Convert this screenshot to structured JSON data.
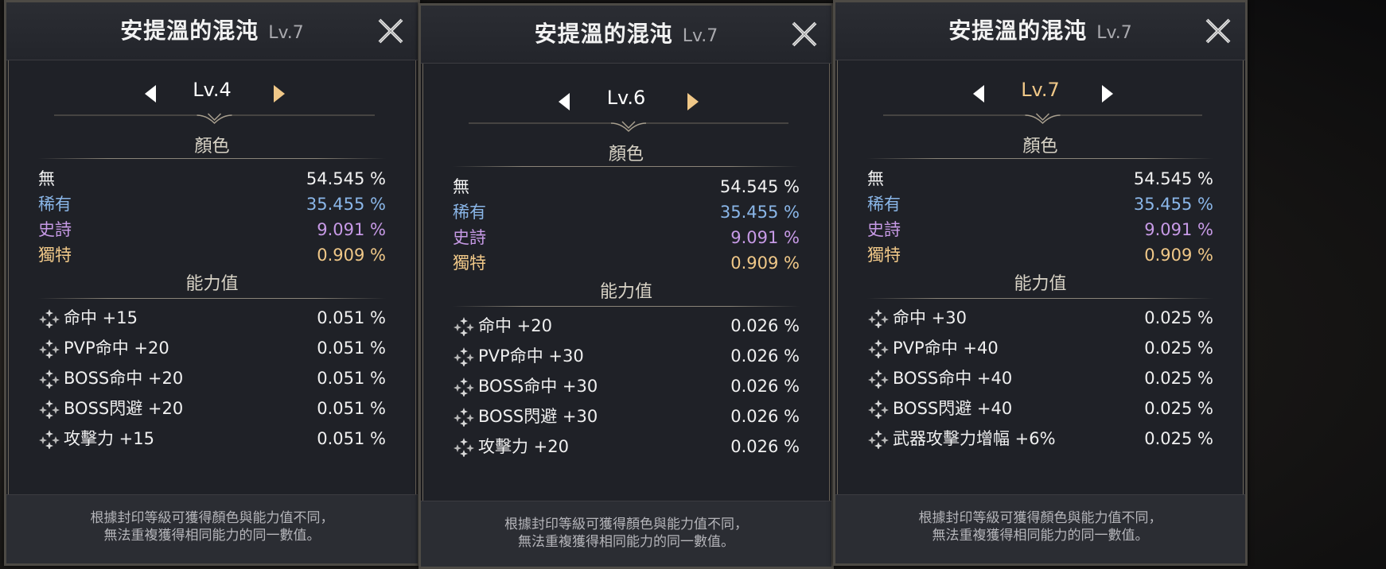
{
  "panels": [
    {
      "title": "安提溫的混沌",
      "title_level": "Lv.7",
      "current_level": "Lv.4",
      "section_color": "顏色",
      "section_stats": "能力值",
      "colors": [
        {
          "label": "無",
          "value": "54.545 %"
        },
        {
          "label": "稀有",
          "value": "35.455 %"
        },
        {
          "label": "史詩",
          "value": "9.091 %"
        },
        {
          "label": "獨特",
          "value": "0.909 %"
        }
      ],
      "stats": [
        {
          "label": "命中 +15",
          "value": "0.051 %"
        },
        {
          "label": "PVP命中 +20",
          "value": "0.051 %"
        },
        {
          "label": "BOSS命中 +20",
          "value": "0.051 %"
        },
        {
          "label": "BOSS閃避 +20",
          "value": "0.051 %"
        },
        {
          "label": "攻擊力 +15",
          "value": "0.051 %"
        }
      ],
      "note_line1": "根據封印等級可獲得顏色與能力值不同，",
      "note_line2": "無法重複獲得相同能力的同一數值。"
    },
    {
      "title": "安提溫的混沌",
      "title_level": "Lv.7",
      "current_level": "Lv.6",
      "section_color": "顏色",
      "section_stats": "能力值",
      "colors": [
        {
          "label": "無",
          "value": "54.545 %"
        },
        {
          "label": "稀有",
          "value": "35.455 %"
        },
        {
          "label": "史詩",
          "value": "9.091 %"
        },
        {
          "label": "獨特",
          "value": "0.909 %"
        }
      ],
      "stats": [
        {
          "label": "命中 +20",
          "value": "0.026 %"
        },
        {
          "label": "PVP命中 +30",
          "value": "0.026 %"
        },
        {
          "label": "BOSS命中 +30",
          "value": "0.026 %"
        },
        {
          "label": "BOSS閃避 +30",
          "value": "0.026 %"
        },
        {
          "label": "攻擊力 +20",
          "value": "0.026 %"
        }
      ],
      "note_line1": "根據封印等級可獲得顏色與能力值不同，",
      "note_line2": "無法重複獲得相同能力的同一數值。"
    },
    {
      "title": "安提溫的混沌",
      "title_level": "Lv.7",
      "current_level": "Lv.7",
      "section_color": "顏色",
      "section_stats": "能力值",
      "colors": [
        {
          "label": "無",
          "value": "54.545 %"
        },
        {
          "label": "稀有",
          "value": "35.455 %"
        },
        {
          "label": "史詩",
          "value": "9.091 %"
        },
        {
          "label": "獨特",
          "value": "0.909 %"
        }
      ],
      "stats": [
        {
          "label": "命中 +30",
          "value": "0.025 %"
        },
        {
          "label": "PVP命中 +40",
          "value": "0.025 %"
        },
        {
          "label": "BOSS命中 +40",
          "value": "0.025 %"
        },
        {
          "label": "BOSS閃避 +40",
          "value": "0.025 %"
        },
        {
          "label": "武器攻擊力增幅 +6%",
          "value": "0.025 %"
        }
      ],
      "note_line1": "根據封印等級可獲得顏色與能力值不同，",
      "note_line2": "無法重複獲得相同能力的同一數值。"
    }
  ],
  "colors_theme": {
    "none": "#f2f2f2",
    "rare": "#8ab6e8",
    "epic": "#c79ae6",
    "unique": "#f0c888",
    "active_arrow": "#f0c888",
    "panel_bg": "#1f2127"
  },
  "icons": {
    "close": "close-icon",
    "prev": "arrow-left-icon",
    "next": "arrow-right-icon",
    "stat": "sparkle-stat-icon"
  }
}
